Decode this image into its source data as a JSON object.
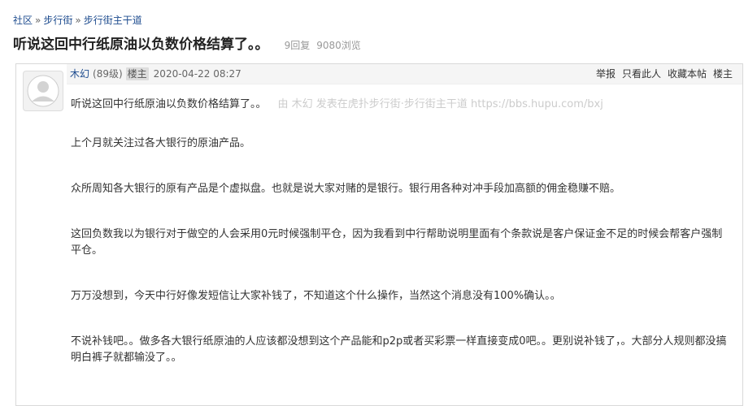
{
  "breadcrumb": {
    "items": [
      "社区",
      "步行街",
      "步行街主干道"
    ],
    "sep": "»"
  },
  "thread": {
    "title": "听说这回中行纸原油以负数价格结算了。。",
    "replies": "9回复",
    "views": "9080浏览"
  },
  "post": {
    "author": "木幻",
    "level": "(89级)",
    "badge": "楼主",
    "date": "2020-04-22 08:27",
    "actions": [
      "举报",
      "只看此人",
      "收藏本帖",
      "楼主"
    ],
    "avatar_icon": "default-avatar-icon",
    "source_note": "由 木幻 发表在虎扑步行街·步行街主干道 https://bbs.hupu.com/bxj",
    "paragraphs": [
      "听说这回中行纸原油以负数价格结算了。。",
      "上个月就关注过各大银行的原油产品。",
      "众所周知各大银行的原有产品是个虚拟盘。也就是说大家对赌的是银行。银行用各种对冲手段加高额的佣金稳赚不赔。",
      "这回负数我以为银行对于做空的人会采用0元时候强制平仓，因为我看到中行帮助说明里面有个条款说是客户保证金不足的时候会帮客户强制平仓。",
      "万万没想到，今天中行好像发短信让大家补钱了，不知道这个什么操作，当然这个消息没有100%确认。。",
      "不说补钱吧。。做多各大银行纸原油的人应该都没想到这个产品能和p2p或者买彩票一样直接变成0吧。。更别说补钱了，。大部分人规则都没搞明白裤子就都输没了。。"
    ]
  },
  "colors": {
    "link": "#1e4c8f",
    "header_bg": "#f5f5f5",
    "muted": "#999999"
  }
}
